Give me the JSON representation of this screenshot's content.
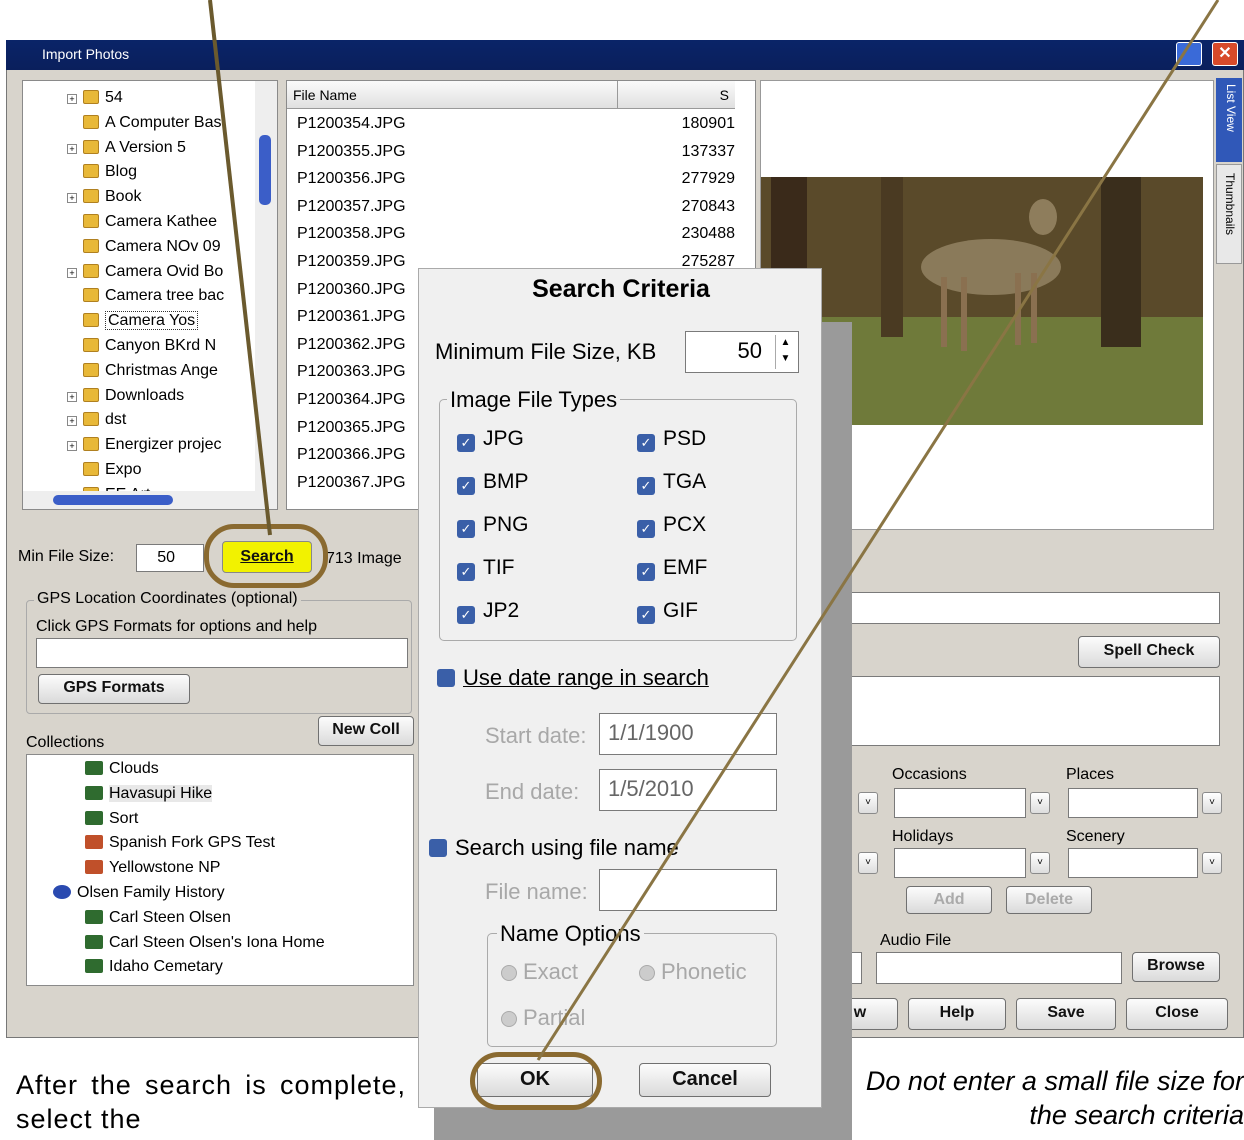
{
  "window": {
    "title": "Import Photos",
    "close_label": "✕"
  },
  "folder_tree": [
    "54",
    "A Computer Bas",
    "A Version 5",
    "Blog",
    "Book",
    "Camera Kathee",
    "Camera NOv 09",
    "Camera Ovid Bo",
    "Camera tree bac",
    "Camera Yos",
    "Canyon BKrd N",
    "Christmas Ange",
    "Downloads",
    "dst",
    "Energizer projec",
    "Expo",
    "EE Art"
  ],
  "file_list": {
    "columns": [
      "File Name",
      "S"
    ],
    "rows": [
      {
        "name": "P1200354.JPG",
        "size": "180901"
      },
      {
        "name": "P1200355.JPG",
        "size": "137337"
      },
      {
        "name": "P1200356.JPG",
        "size": "277929"
      },
      {
        "name": "P1200357.JPG",
        "size": "270843"
      },
      {
        "name": "P1200358.JPG",
        "size": "230488"
      },
      {
        "name": "P1200359.JPG",
        "size": "275287"
      },
      {
        "name": "P1200360.JPG",
        "size": ""
      },
      {
        "name": "P1200361.JPG",
        "size": ""
      },
      {
        "name": "P1200362.JPG",
        "size": ""
      },
      {
        "name": "P1200363.JPG",
        "size": ""
      },
      {
        "name": "P1200364.JPG",
        "size": ""
      },
      {
        "name": "P1200365.JPG",
        "size": ""
      },
      {
        "name": "P1200366.JPG",
        "size": ""
      },
      {
        "name": "P1200367.JPG",
        "size": ""
      }
    ]
  },
  "side_tabs": [
    "List View",
    "Thumbnails"
  ],
  "search_bar": {
    "min_label": "Min File Size:",
    "min_value": "50",
    "search_label": "Search",
    "count_text": "713 Image"
  },
  "gps": {
    "group_label": "GPS Location Coordinates (optional)",
    "help_text": "Click GPS Formats for options and help",
    "formats_button": "GPS Formats"
  },
  "collections": {
    "label": "Collections",
    "new_button": "New Coll",
    "items": [
      "Clouds",
      "Havasupi Hike",
      "Sort",
      "Spanish Fork GPS Test",
      "Yellowstone NP",
      "Olsen Family History",
      "Carl Steen Olsen",
      "Carl Steen Olsen's Iona Home",
      "Idaho Cemetary"
    ]
  },
  "right_panel": {
    "spell_check": "Spell Check",
    "occasions": "Occasions",
    "places": "Places",
    "holidays": "Holidays",
    "scenery": "Scenery",
    "add": "Add",
    "delete": "Delete",
    "audio_file": "Audio File",
    "browse": "Browse"
  },
  "bottom_buttons": {
    "partial": "w",
    "help": "Help",
    "save": "Save",
    "close": "Close"
  },
  "dialog": {
    "title": "Search Criteria",
    "min_size_label": "Minimum File Size, KB",
    "min_size_value": "50",
    "types_group": "Image File Types",
    "types": [
      "JPG",
      "PSD",
      "BMP",
      "TGA",
      "PNG",
      "PCX",
      "TIF",
      "EMF",
      "JP2",
      "GIF"
    ],
    "date_range_label": "Use date range in search",
    "start_label": "Start date:",
    "start_value": "1/1/1900",
    "end_label": "End date:",
    "end_value": "1/5/2010",
    "filename_label": "Search using file name",
    "filename_field_label": "File name:",
    "name_options": "Name Options",
    "exact": "Exact",
    "phonetic": "Phonetic",
    "partial": "Partial",
    "ok": "OK",
    "cancel": "Cancel"
  },
  "captions": {
    "left": "After the search is complete, select the",
    "right": "Do not enter a small file size for the search criteria"
  },
  "colors": {
    "highlight": "#f2f200",
    "ring": "#8a6a30",
    "check": "#3a5fa8"
  }
}
